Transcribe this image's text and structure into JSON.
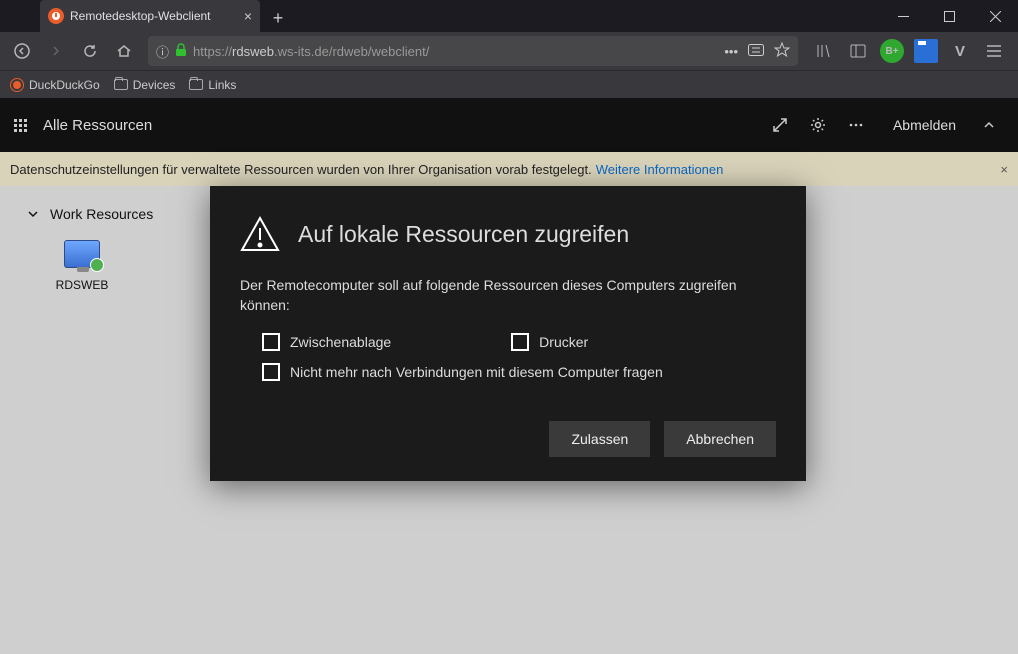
{
  "browser": {
    "tab_title": "Remotedesktop-Webclient",
    "url_prefix": "https://",
    "url_host": "rdsweb",
    "url_rest": ".ws-its.de/rdweb/webclient/",
    "bookmarks": {
      "ddg": "DuckDuckGo",
      "devices": "Devices",
      "links": "Links"
    }
  },
  "appbar": {
    "title": "Alle Ressourcen",
    "logout": "Abmelden"
  },
  "infobar": {
    "text": "Datenschutzeinstellungen für verwaltete Ressourcen wurden von Ihrer Organisation vorab festgelegt.",
    "link": "Weitere Informationen"
  },
  "workspace": {
    "group": "Work Resources",
    "resource": "RDSWEB"
  },
  "dialog": {
    "title": "Auf lokale Ressourcen zugreifen",
    "desc": "Der Remotecomputer soll auf folgende Ressourcen dieses Computers zugreifen können:",
    "clipboard": "Zwischenablage",
    "printer": "Drucker",
    "dont_ask": "Nicht mehr nach Verbindungen mit diesem Computer fragen",
    "allow": "Zulassen",
    "cancel": "Abbrechen"
  }
}
